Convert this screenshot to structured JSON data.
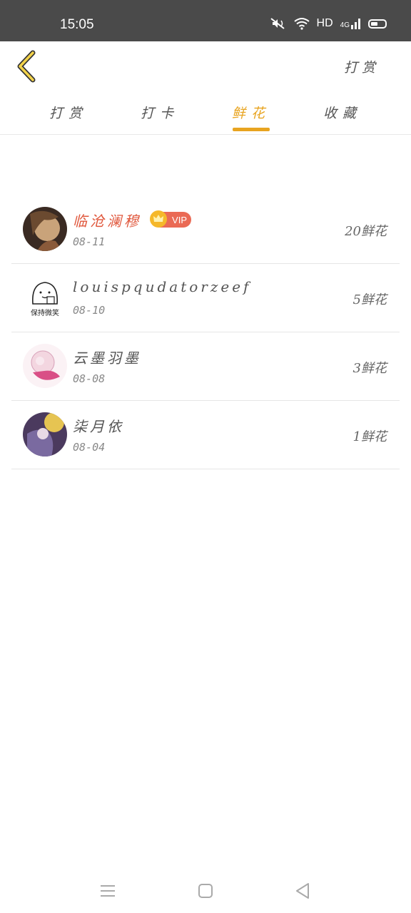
{
  "status_bar": {
    "time": "15:05",
    "network_label": "HD",
    "signal_label": "4G"
  },
  "header": {
    "action_label": "打赏"
  },
  "tabs": [
    {
      "label": "打赏",
      "active": false
    },
    {
      "label": "打卡",
      "active": false
    },
    {
      "label": "鲜花",
      "active": true
    },
    {
      "label": "收藏",
      "active": false
    }
  ],
  "colors": {
    "accent": "#e8a420",
    "vip_name": "#e0573c",
    "vip_badge": "#ea6a55"
  },
  "list": [
    {
      "name": "临沧澜穆",
      "vip": true,
      "vip_label": "VIP",
      "date": "08-11",
      "amount": "20鲜花"
    },
    {
      "name": "louispqudatorzeef",
      "vip": false,
      "date": "08-10",
      "amount": "5鲜花"
    },
    {
      "name": "云墨羽墨",
      "vip": false,
      "date": "08-08",
      "amount": "3鲜花"
    },
    {
      "name": "柒月依",
      "vip": false,
      "date": "08-04",
      "amount": "1鲜花"
    }
  ],
  "avatar_caption": "保持微笑"
}
